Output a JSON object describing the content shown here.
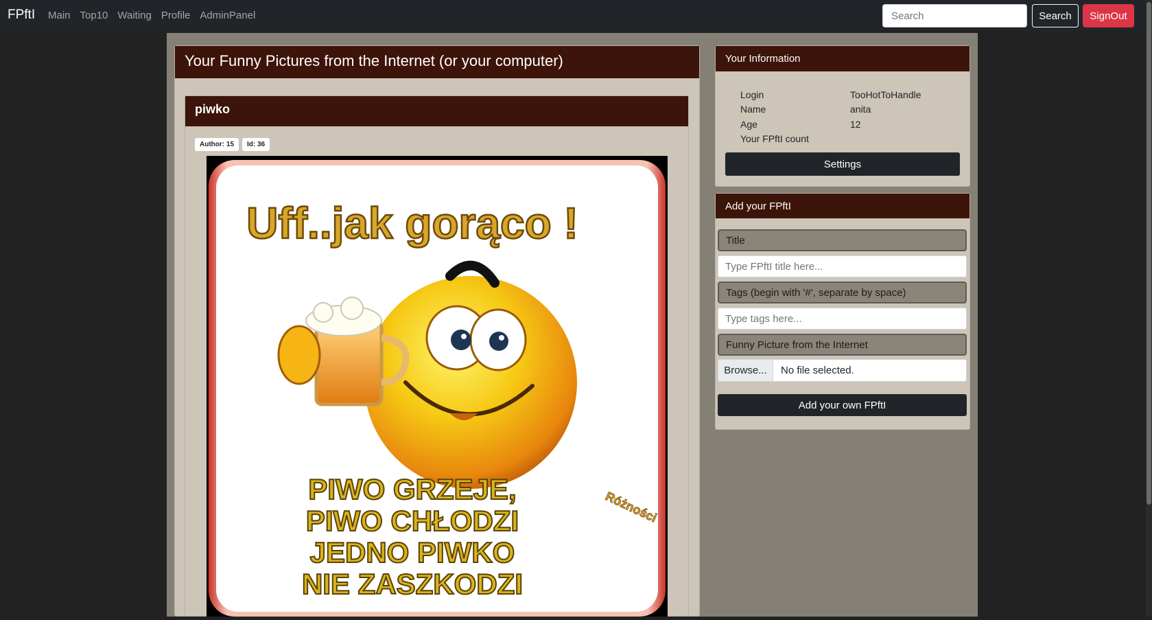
{
  "nav": {
    "brand": "FPftI",
    "links": [
      "Main",
      "Top10",
      "Waiting",
      "Profile",
      "AdminPanel"
    ],
    "search_placeholder": "Search",
    "search_button": "Search",
    "signout_button": "SignOut"
  },
  "main": {
    "header": "Your Funny Pictures from the Internet (or your computer)",
    "post": {
      "title": "piwko",
      "author_badge": "Author: 15",
      "id_badge": "Id: 36",
      "image_text": {
        "top": "Uff..jak gorąco !",
        "line1": "PIWO GRZEJE,",
        "line2": "PIWO CHŁODZI",
        "line3": "JEDNO PIWKO",
        "line4": "NIE ZASZKODZI",
        "corner": "Różności"
      }
    }
  },
  "info": {
    "header": "Your Information",
    "rows": [
      {
        "label": "Login",
        "value": "TooHotToHandle"
      },
      {
        "label": "Name",
        "value": "anita"
      },
      {
        "label": "Age",
        "value": "12"
      },
      {
        "label": "Your FPftI count",
        "value": ""
      }
    ],
    "settings_button": "Settings"
  },
  "add": {
    "header": "Add your FPftI",
    "title_label": "Title",
    "title_placeholder": "Type FPftI title here...",
    "tags_label": "Tags (begin with '#', separate by space)",
    "tags_placeholder": "Type tags here...",
    "picture_label": "Funny Picture from the Internet",
    "browse_button": "Browse...",
    "file_status": "No file selected.",
    "submit_button": "Add your own FPftI"
  },
  "colors": {
    "navbar": "#212529",
    "header_brown": "#3c1409",
    "card_beige": "#ccc5b8",
    "page_bg": "#858076",
    "signout_red": "#dc3545"
  }
}
